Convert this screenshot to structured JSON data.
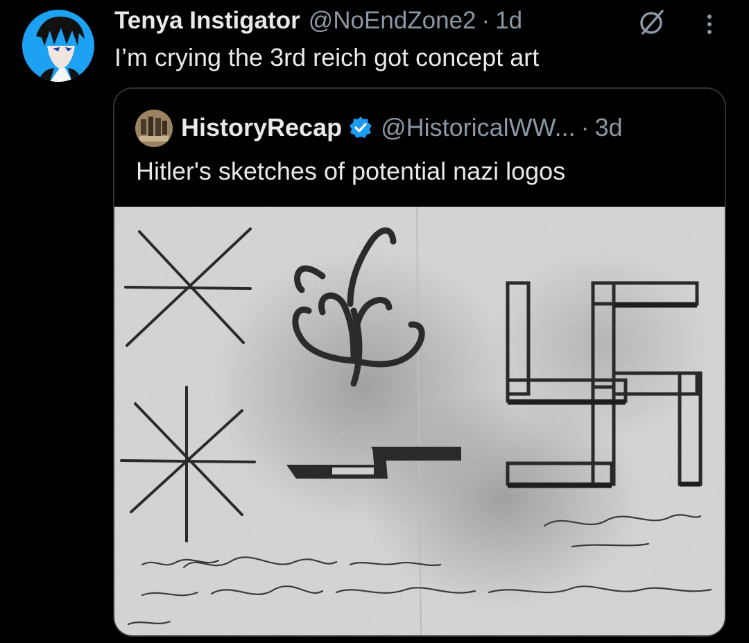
{
  "tweet": {
    "author_name": "Tenya Instigator",
    "author_handle": "@NoEndZone2",
    "separator": "·",
    "time": "1d",
    "text": "I’m crying the 3rd reich got concept art",
    "avatar_icon": "anime-avatar",
    "grok_icon": "grok-icon",
    "more_icon": "more-options-icon"
  },
  "quoted_tweet": {
    "author_name": "HistoryRecap",
    "verified": true,
    "author_handle": "@HistoricalWW...",
    "separator": "·",
    "time": "3d",
    "text": "Hitler's sketches of potential nazi logos",
    "media": {
      "type": "photo",
      "content": "scanned grayscale sketch page of symbol drafts with handwritten notes"
    }
  },
  "colors": {
    "background": "#000000",
    "primary_text": "#e7e9ea",
    "secondary_text": "#8b98a5",
    "border": "#2f3336",
    "verified_blue": "#1d9bf0"
  }
}
